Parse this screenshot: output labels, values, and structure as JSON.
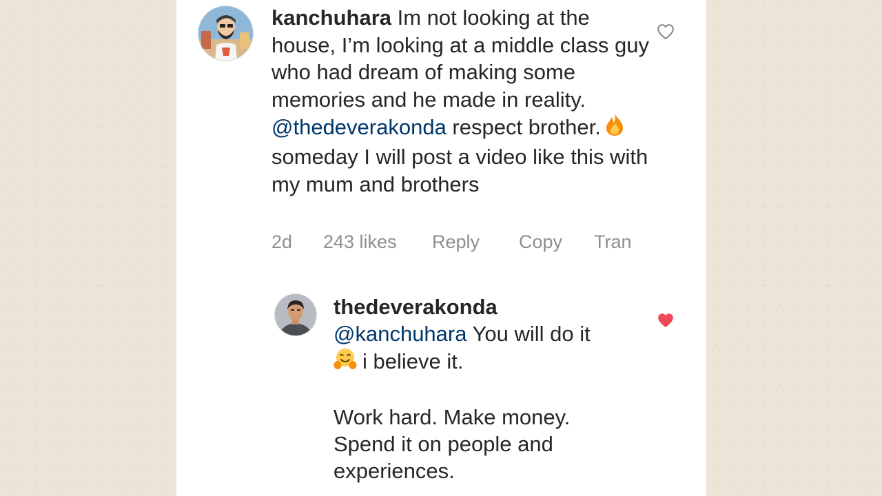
{
  "comment": {
    "username": "kanchuhara",
    "text_part1": " Im not looking at the house, I’m looking at a middle class guy who had dream of making some memories and he made in reality. ",
    "mention": "@thedeverakonda",
    "text_part2": " respect brother.",
    "emoji": "fire",
    "text_part3": "someday I will post a video like this with my mum and brothers",
    "meta": {
      "time": "2d",
      "likes": "243 likes",
      "reply": "Reply",
      "copy": "Copy",
      "translate": "Tran"
    },
    "liked": false,
    "like_icon": "heart-outline-icon"
  },
  "reply": {
    "username": "thedeverakonda",
    "mention": "@kanchuhara",
    "text_line1": " You will do it",
    "emoji": "hugging-face",
    "text_line2": "i believe it.",
    "text_line3": "Work hard. Make money.",
    "text_line4": "Spend it on people and",
    "text_line5": "experiences.",
    "liked": true,
    "like_color": "#ed4956",
    "like_icon": "heart-filled-icon"
  },
  "colors": {
    "background": "#ede3d6",
    "panel": "#ffffff",
    "text": "#262626",
    "secondary_text": "#8e8e8e",
    "mention": "#00376b"
  }
}
